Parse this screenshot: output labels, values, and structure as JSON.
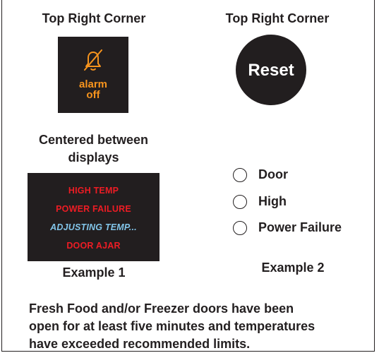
{
  "labels": {
    "top_left": "Top Right Corner",
    "top_right": "Top Right Corner",
    "centered_line1": "Centered between",
    "centered_line2": "displays",
    "example1": "Example 1",
    "example2": "Example 2"
  },
  "alarm_button": {
    "icon": "bell-slash-icon",
    "line1": "alarm",
    "line2": "off",
    "accent_color": "#f7941d"
  },
  "reset_button": {
    "label": "Reset"
  },
  "display": {
    "lines": [
      "HIGH TEMP",
      "POWER FAILURE",
      "ADJUSTING TEMP...",
      "DOOR AJAR"
    ],
    "red_color": "#ed1c24",
    "blue_color": "#82c5e9"
  },
  "indicators": [
    "Door",
    "High",
    "Power Failure"
  ],
  "description": {
    "line1": "Fresh Food and/or Freezer doors have been",
    "line2": "open for at least five minutes and temperatures",
    "line3": "have exceeded recommended limits."
  }
}
